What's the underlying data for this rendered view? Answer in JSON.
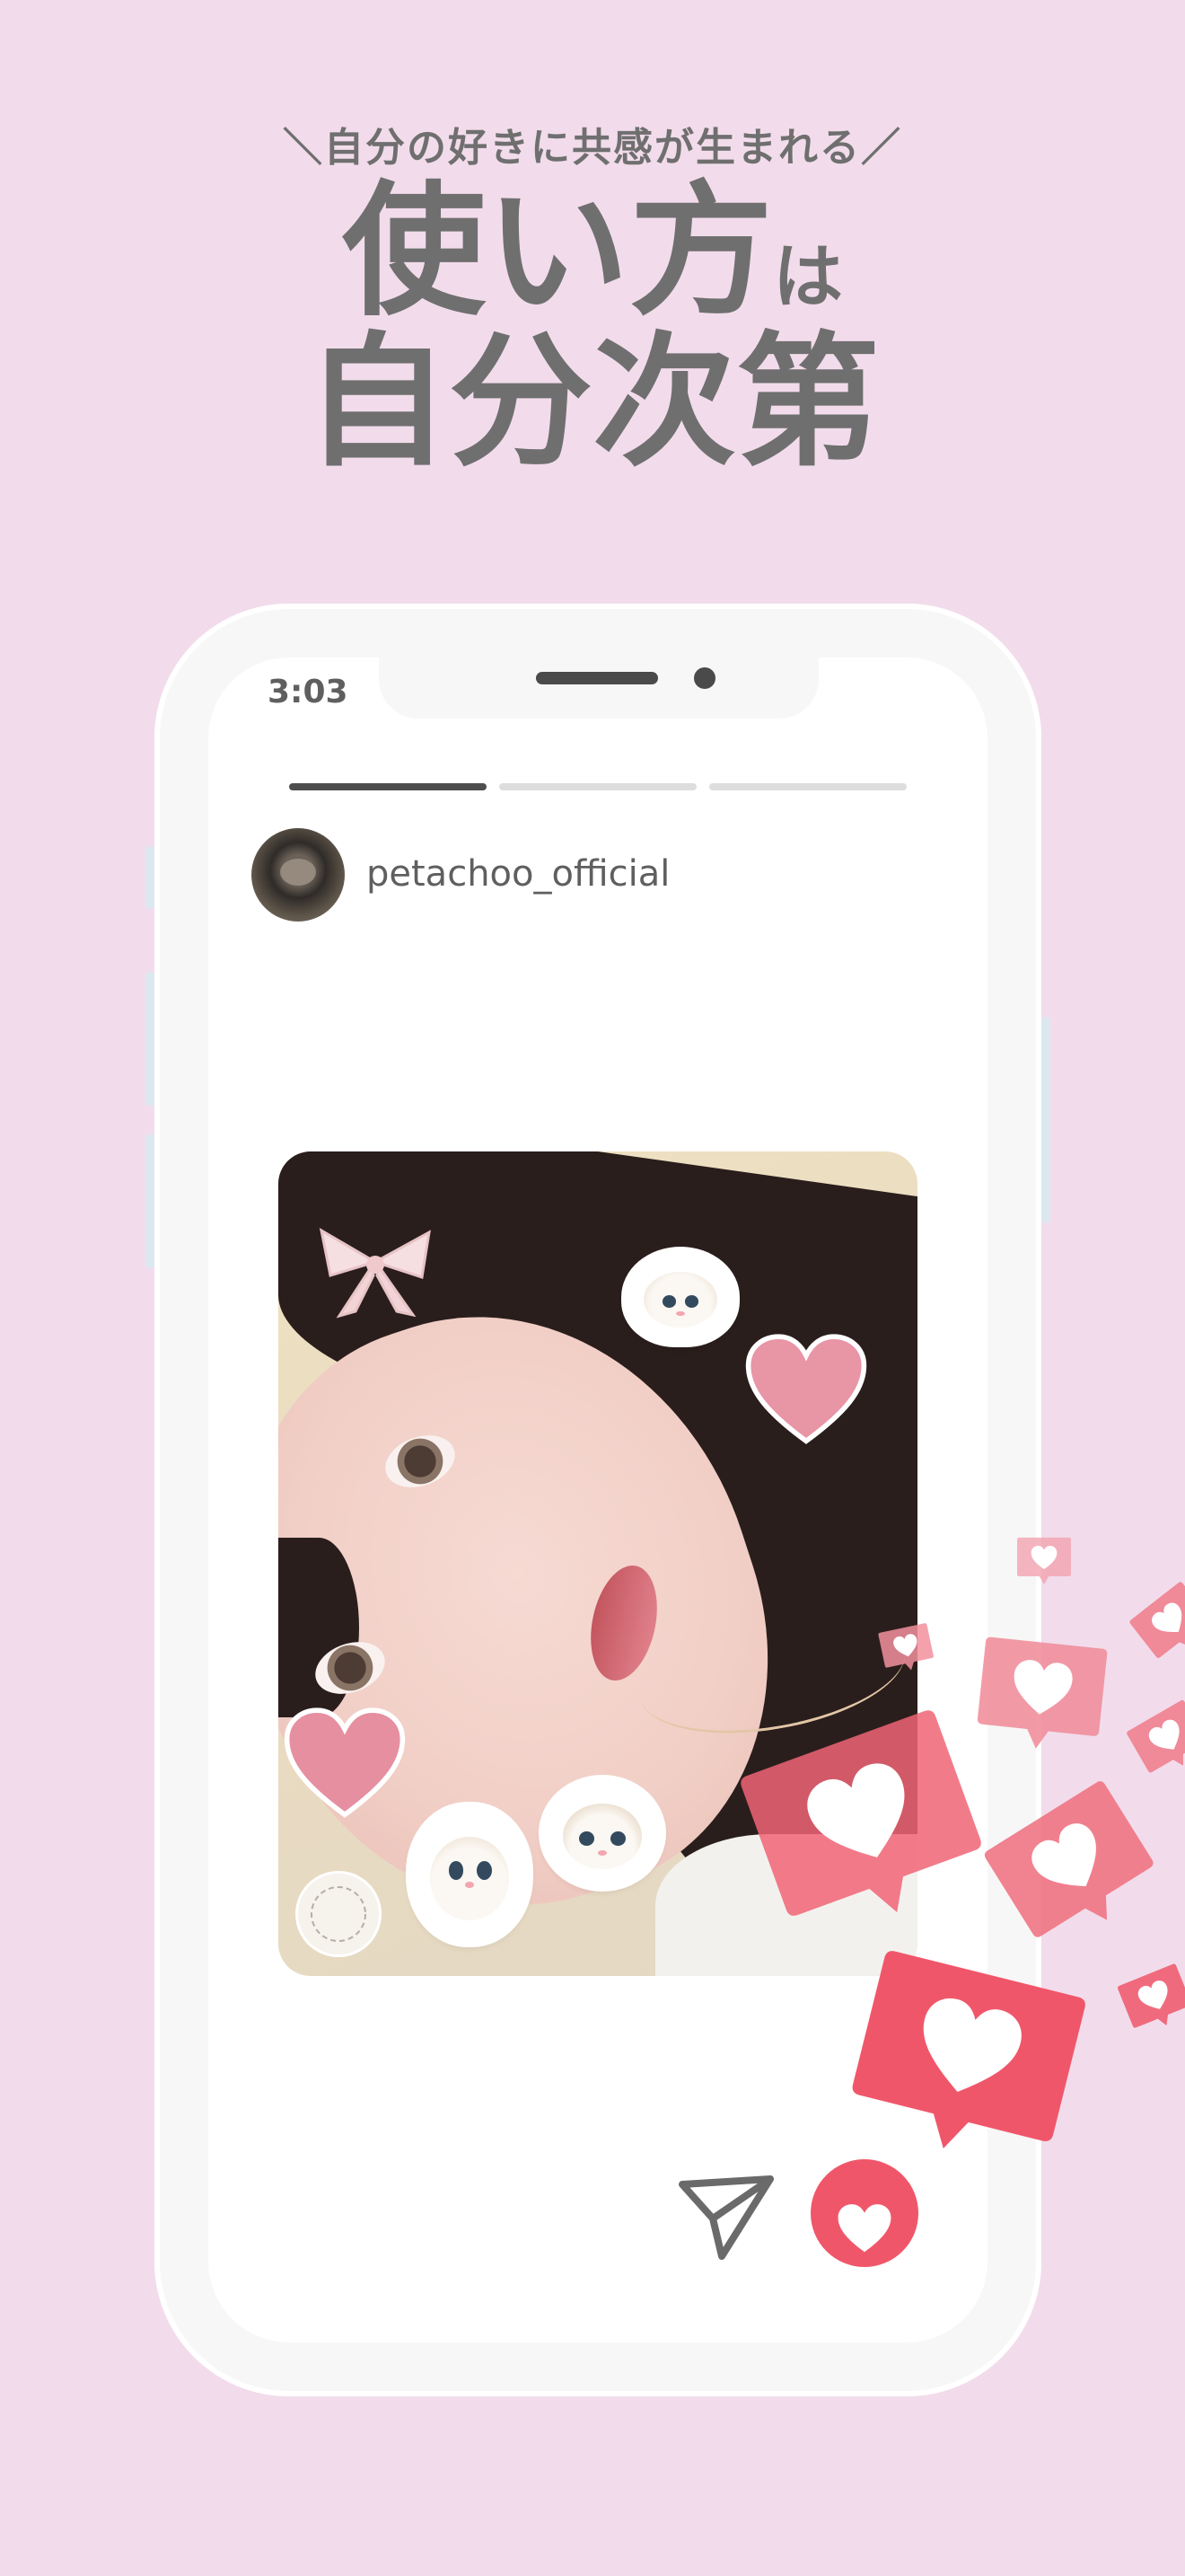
{
  "headline": {
    "subtitle": "＼自分の好きに共感が生まれる／",
    "line1": "使い方",
    "line1_suffix": "は",
    "line2": "自分次第"
  },
  "status_bar": {
    "time": "3:03"
  },
  "story": {
    "segments_total": 3,
    "active_segment": 1,
    "username": "petachoo_official",
    "avatar_icon": "cat-photo-avatar"
  },
  "actions": {
    "send_icon": "paper-plane-icon",
    "like_icon": "heart-icon"
  },
  "colors": {
    "background": "#f2dceb",
    "text_gray": "#6f6f6f",
    "like_red": "#f0566a",
    "like_pink": "#f07a8a"
  }
}
